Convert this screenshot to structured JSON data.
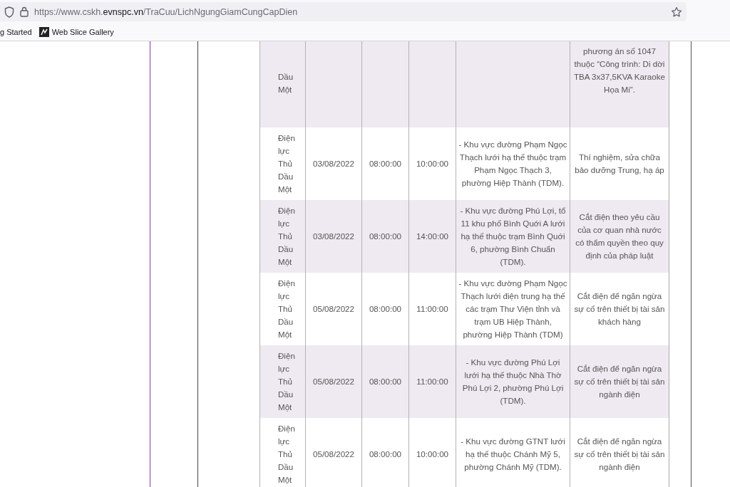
{
  "browser": {
    "url": "https://www.cskh.**evnspc.vn**/TraCuu/LichNgungGiamCungCapDien",
    "bookmarks": [
      {
        "label": "g Started",
        "kind": "plain"
      },
      {
        "label": "Web Slice Gallery",
        "kind": "slice"
      }
    ]
  },
  "table": {
    "rows": [
      {
        "unit": "Dầu Một",
        "date": "",
        "start": "",
        "end": "",
        "area": "",
        "reason": "phương án số 1047 thuộc “Công trình: Di dời TBA 3x37,5KVA Karaoke Họa Mi”.",
        "partial": true
      },
      {
        "unit": "Điện lực Thủ Dầu Một",
        "date": "03/08/2022",
        "start": "08:00:00",
        "end": "10:00:00",
        "area": "- Khu vực đường Phạm Ngọc Thạch lưới hạ thế thuộc trạm Phạm Ngọc Thạch 3, phường Hiệp Thành (TDM).",
        "reason": "Thí nghiệm, sửa chữa bảo dưỡng Trung, hạ áp",
        "partial": false
      },
      {
        "unit": "Điện lực Thủ Dầu Một",
        "date": "03/08/2022",
        "start": "08:00:00",
        "end": "14:00:00",
        "area": "- Khu vực đường Phú Lợi, tổ 11 khu phố Bình Quới A lưới hạ thế thuộc trạm Bình Quới 6, phường Bình Chuẩn (TDM).",
        "reason": "Cắt điện theo yêu cầu của cơ quan nhà nước có thẩm quyền theo quy định của pháp luật",
        "partial": false
      },
      {
        "unit": "Điện lực Thủ Dầu Một",
        "date": "05/08/2022",
        "start": "08:00:00",
        "end": "11:00:00",
        "area": "- Khu vực đường Phạm Ngọc Thạch lưới điện trung hạ thế các trạm Thư Viện tỉnh và trạm UB Hiệp Thành, phường Hiệp Thành (TDM)",
        "reason": "Cắt điện để ngăn ngừa sự cố trên thiết bị tài sản khách hàng",
        "partial": false
      },
      {
        "unit": "Điện lực Thủ Dầu Một",
        "date": "05/08/2022",
        "start": "08:00:00",
        "end": "11:00:00",
        "area": "- Khu vực đường Phú Lợi lưới hạ thế thuộc Nhà Thờ Phú Lợi 2, phường Phú Lợi (TDM).",
        "reason": "Cắt điện để ngăn ngừa sự cố trên thiết bị tài sản ngành điện",
        "partial": false
      },
      {
        "unit": "Điện lực Thủ Dầu Một",
        "date": "05/08/2022",
        "start": "08:00:00",
        "end": "10:00:00",
        "area": "- Khu vực đường GTNT lưới hạ thế thuộc Chánh Mỹ 5, phường Chánh Mỹ (TDM).",
        "reason": "Cắt điện để ngăn ngừa sự cố trên thiết bị tài sản ngành điện",
        "partial": false
      }
    ]
  }
}
